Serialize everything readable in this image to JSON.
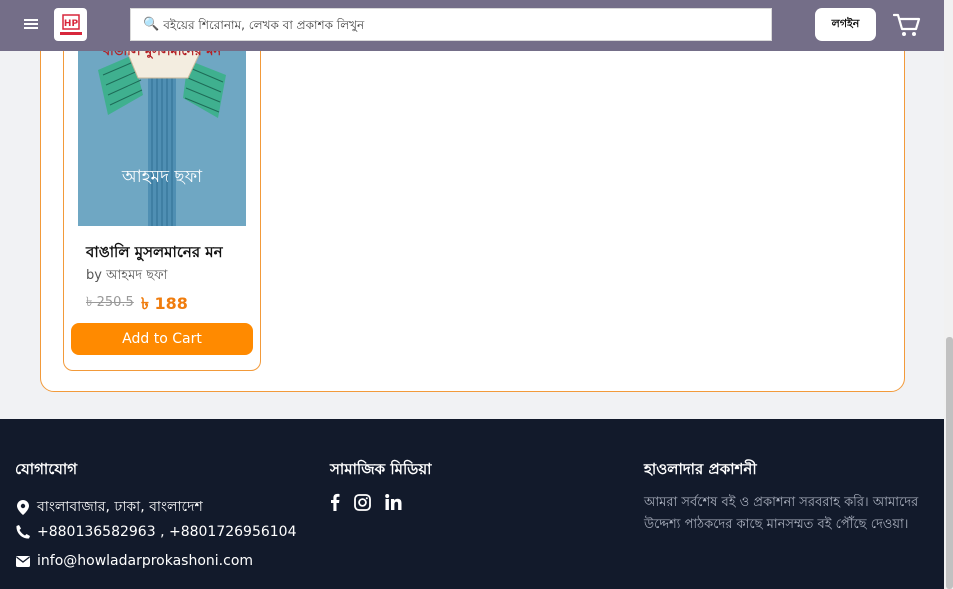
{
  "header": {
    "menu_icon": "hamburger-menu-icon",
    "logo_alt": "হাওলাদার প্রকাশনী",
    "search_placeholder": "বইয়ের শিরোনাম, লেখক বা প্রকাশক লিখুন",
    "login_label": "লগইন",
    "cart_icon": "shopping-cart-icon"
  },
  "product": {
    "cover_title": "বাঙালি মুসলমানের মন",
    "cover_author": "আহমদ ছফা",
    "title": "বাঙালি মুসলমানের মন",
    "author": "by আহমদ ছফা",
    "old_price": "৳ 250.5",
    "new_price": "৳ 188",
    "add_to_cart_label": "Add to Cart"
  },
  "footer": {
    "contact": {
      "heading": "যোগাযোগ",
      "address": "বাংলাবাজার, ঢাকা, বাংলাদেশ",
      "phone": "+880136582963 , +8801726956104",
      "email": "info@howladarprokashoni.com"
    },
    "social": {
      "heading": "সামাজিক মিডিয়া",
      "icons": [
        "facebook-icon",
        "instagram-icon",
        "linkedin-icon"
      ]
    },
    "about": {
      "heading": "হাওলাদার প্রকাশনী",
      "text": "আমরা সর্বশেষ বই ও প্রকাশনা সরবরাহ করি। আমাদের উদ্দেশ্য পাঠকদের কাছে মানসম্মত বই পৌঁছে দেওয়া।"
    }
  },
  "colors": {
    "header_bg": "#746e88",
    "accent": "#ff8a00",
    "footer_bg": "#121a2b"
  }
}
